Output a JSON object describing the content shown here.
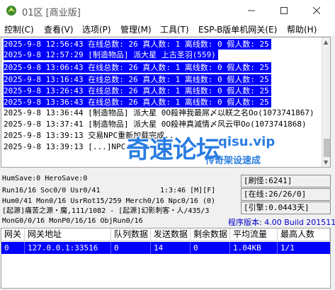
{
  "window": {
    "title": "01区 [商业版]"
  },
  "menu": [
    "控制(C)",
    "查看(V)",
    "选项(P)",
    "管理(M)",
    "工具(T)",
    "ESP-B版单机网关(E)",
    "帮助(H)"
  ],
  "log_lines": [
    {
      "text": "2025-9-8 12:56:43 在线总数: 26 真人数: 1 离线数: 0 假人数: 25",
      "selected": true
    },
    {
      "text": "2025-9-8 12:57:29 [制造物品] 派大星 上古圣羽(559)",
      "selected": true
    },
    {
      "text": "2025-9-8 13:06:43 在线总数: 26 真人数: 1 离线数: 0 假人数: 25",
      "selected": true
    },
    {
      "text": "2025-9-8 13:16:43 在线总数: 26 真人数: 1 离线数: 0 假人数: 25",
      "selected": true
    },
    {
      "text": "2025-9-8 13:26:43 在线总数: 26 真人数: 1 离线数: 0 假人数: 25",
      "selected": true
    },
    {
      "text": "2025-9-8 13:36:43 在线总数: 26 真人数: 1 离线数: 0 假人数: 25",
      "selected": true
    },
    {
      "text": "2025-9-8 13:36:44 [制造物品] 派大星 0O殺神我最屌〆以眹之名Oo(1073741867)",
      "selected": false
    },
    {
      "text": "2025-9-8 13:37:41 [制造物品] 派大星 0O殺神真滅情〆风云甲Oo(1073741868)",
      "selected": false
    },
    {
      "text": "2025-9-8 13:39:13 交易NPC重新加载完成...",
      "selected": false
    },
    {
      "text": "2025-9-8 13:39:13 [...]NPC...",
      "selected": false
    }
  ],
  "watermark": {
    "logo": "奇速论坛",
    "url": "qisu.vip",
    "slogan": "传奇架设速成"
  },
  "status": {
    "hum_save": "HumSave:0 HeroSave:0",
    "run_line": "Run16/16 Soc0/0 Usr0/41",
    "time": "1:3:46 [M][F]",
    "hum_line": "Hum0/41 Mon0/16 UsrRot15/259 Merch0/16 Npc0/16 (0)",
    "origin_line": "[起源]痛苦之源・魔,111/1082 - [起源]幻影刺客・人/435/3",
    "mon_line": "MonG0/0/16 MonP0/16/16 ObjRun0/16",
    "refresh": "[刷怪:6241]",
    "online": "[在线:26/26/0]",
    "engine": "[引擎:0.0443天]",
    "version": "程序版本: 4.00 Build 20151104"
  },
  "gateway_table": {
    "columns": [
      "网关",
      "网关地址",
      "队列数据",
      "发送数据",
      "剩余数据",
      "平均流量",
      "最高人数"
    ],
    "rows": [
      [
        "0",
        "127.0.0.1:33516",
        "0",
        "14",
        "0",
        "1.04KB",
        "1/1"
      ]
    ]
  },
  "colors": {
    "selection": "#0000ff",
    "watermark": "#2a7de1",
    "version_text": "#0000cc"
  }
}
